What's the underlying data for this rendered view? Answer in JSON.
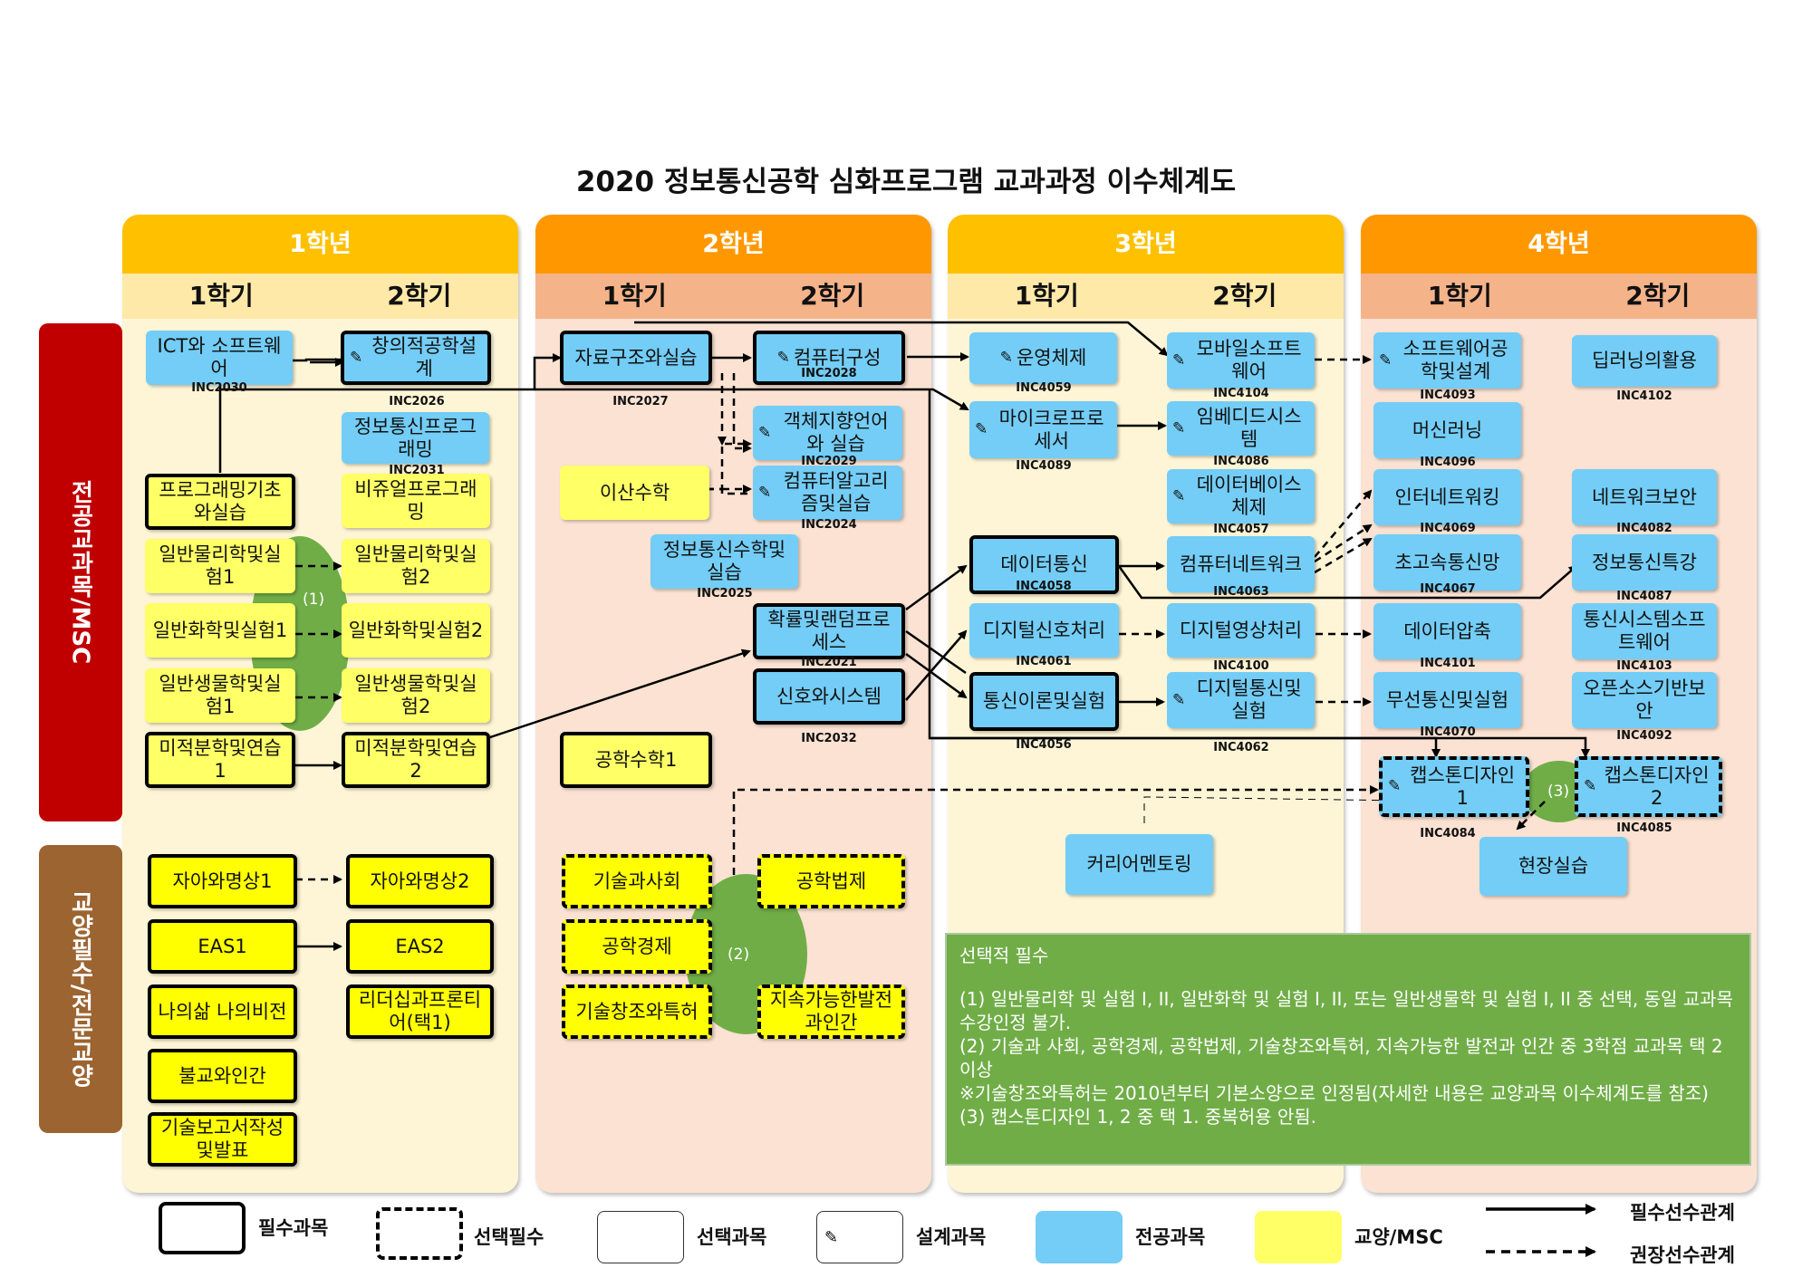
{
  "title": "2020 정보통신공학 심화프로그램 교과과정 이수체계도",
  "years": [
    {
      "label": "1학년",
      "sem1": "1학기",
      "sem2": "2학기"
    },
    {
      "label": "2학년",
      "sem1": "1학기",
      "sem2": "2학기"
    },
    {
      "label": "3학년",
      "sem1": "1학기",
      "sem2": "2학기"
    },
    {
      "label": "4학년",
      "sem1": "1학기",
      "sem2": "2학기"
    }
  ],
  "side": {
    "major": "전공교과목/MSC",
    "liberal": "교양필수/전문교양"
  },
  "courses": {
    "c01": {
      "name": "ICT와 소프트웨어",
      "code": "INC2030"
    },
    "c02": {
      "name": "창의적공학설계",
      "code": "INC2026"
    },
    "c03": {
      "name": "정보통신프로그래밍",
      "code": "INC2031"
    },
    "c04": {
      "name": "프로그래밍기초와실습",
      "code": ""
    },
    "c05": {
      "name": "비쥬얼프로그래밍",
      "code": ""
    },
    "c06": {
      "name": "일반물리학및실험1",
      "code": ""
    },
    "c07": {
      "name": "일반물리학및실험2",
      "code": ""
    },
    "c08": {
      "name": "일반화학및실험1",
      "code": ""
    },
    "c09": {
      "name": "일반화학및실험2",
      "code": ""
    },
    "c10": {
      "name": "일반생물학및실험1",
      "code": ""
    },
    "c11": {
      "name": "일반생물학및실험2",
      "code": ""
    },
    "c12": {
      "name": "미적분학및연습1",
      "code": ""
    },
    "c13": {
      "name": "미적분학및연습2",
      "code": ""
    },
    "c14": {
      "name": "자료구조와실습",
      "code": "INC2027"
    },
    "c15": {
      "name": "컴퓨터구성",
      "code": "INC2028"
    },
    "c16": {
      "name": "객체지향언어와 실습",
      "code": "INC2029"
    },
    "c17": {
      "name": "컴퓨터알고리즘및실습",
      "code": "INC2024"
    },
    "c18": {
      "name": "이산수학",
      "code": ""
    },
    "c19": {
      "name": "정보통신수학및실습",
      "code": "INC2025"
    },
    "c20": {
      "name": "확률및랜덤프로세스",
      "code": "INC2021"
    },
    "c21": {
      "name": "신호와시스템",
      "code": "INC2032"
    },
    "c22": {
      "name": "공학수학1",
      "code": ""
    },
    "c23": {
      "name": "운영체제",
      "code": "INC4059"
    },
    "c24": {
      "name": "마이크로프로세서",
      "code": "INC4089"
    },
    "c25": {
      "name": "데이터통신",
      "code": "INC4058"
    },
    "c26": {
      "name": "디지털신호처리",
      "code": "INC4061"
    },
    "c27": {
      "name": "통신이론및실험",
      "code": "INC4056"
    },
    "c28": {
      "name": "모바일소프트웨어",
      "code": "INC4104"
    },
    "c29": {
      "name": "임베디드시스템",
      "code": "INC4086"
    },
    "c30": {
      "name": "데이터베이스체제",
      "code": "INC4057"
    },
    "c31": {
      "name": "컴퓨터네트워크",
      "code": "INC4063"
    },
    "c32": {
      "name": "디지털영상처리",
      "code": "INC4100"
    },
    "c33": {
      "name": "디지털통신및실험",
      "code": "INC4062"
    },
    "c34": {
      "name": "커리어멘토링",
      "code": ""
    },
    "c35": {
      "name": "소프트웨어공학및설계",
      "code": "INC4093"
    },
    "c36": {
      "name": "머신러닝",
      "code": "INC4096"
    },
    "c37": {
      "name": "인터네트워킹",
      "code": "INC4069"
    },
    "c38": {
      "name": "초고속통신망",
      "code": "INC4067"
    },
    "c39": {
      "name": "데이터압축",
      "code": "INC4101"
    },
    "c40": {
      "name": "무선통신및실험",
      "code": "INC4070"
    },
    "c41": {
      "name": "캡스톤디자인1",
      "code": "INC4084"
    },
    "c42": {
      "name": "딥러닝의활용",
      "code": "INC4102"
    },
    "c43": {
      "name": "네트워크보안",
      "code": "INC4082"
    },
    "c44": {
      "name": "정보통신특강",
      "code": "INC4087"
    },
    "c45": {
      "name": "통신시스템소프트웨어",
      "code": "INC4103"
    },
    "c46": {
      "name": "오픈소스기반보안",
      "code": "INC4092"
    },
    "c47": {
      "name": "캡스톤디자인2",
      "code": "INC4085"
    },
    "c48": {
      "name": "현장실습",
      "code": ""
    },
    "c49": {
      "name": "자아와명상1",
      "code": ""
    },
    "c50": {
      "name": "자아와명상2",
      "code": ""
    },
    "c51": {
      "name": "EAS1",
      "code": ""
    },
    "c52": {
      "name": "EAS2",
      "code": ""
    },
    "c53": {
      "name": "나의삶 나의비전",
      "code": ""
    },
    "c54": {
      "name": "리더십과프론티어(택1)",
      "code": ""
    },
    "c55": {
      "name": "불교와인간",
      "code": ""
    },
    "c56": {
      "name": "기술보고서작성및발표",
      "code": ""
    },
    "c57": {
      "name": "기술과사회",
      "code": ""
    },
    "c58": {
      "name": "공학법제",
      "code": ""
    },
    "c59": {
      "name": "공학경제",
      "code": ""
    },
    "c60": {
      "name": "기술창조와특허",
      "code": ""
    },
    "c61": {
      "name": "지속가능한발전과인간",
      "code": ""
    }
  },
  "groups": {
    "g1": "(1)",
    "g2": "(2)",
    "g3": "(3)"
  },
  "note": {
    "title": "선택적 필수",
    "line1": "(1) 일반물리학 및 실험 I, II, 일반화학 및 실험 I, II, 또는 일반생물학 및 실험 I, II 중 선택, 동일 교과목 수강인정 불가.",
    "line2": "(2) 기술과 사회, 공학경제, 공학법제, 기술창조와특허, 지속가능한 발전과 인간 중 3학점 교과목 택 2 이상",
    "line3": "※기술창조와특허는 2010년부터 기본소양으로 인정됨(자세한 내용은 교양과목 이수체계도를 참조)",
    "line4": "(3) 캡스톤디자인 1, 2 중 택 1. 중복허용 안됨."
  },
  "legend": {
    "required": "필수과목",
    "selective_required": "선택필수",
    "elective": "선택과목",
    "design": "설계과목",
    "major": "전공과목",
    "liberal": "교양/MSC",
    "req_prereq": "필수선수관계",
    "rec_prereq": "권장선수관계"
  },
  "colors": {
    "major": "#73cdf6",
    "liberal": "#ffff66",
    "year1": "#ffc000",
    "year2": "#ff9800",
    "year3": "#ffc000",
    "year4": "#ff9800",
    "side_major": "#c00000",
    "side_liberal": "#9c6430",
    "group": "#70ad47"
  },
  "icons": {
    "design": "pencil-icon"
  }
}
